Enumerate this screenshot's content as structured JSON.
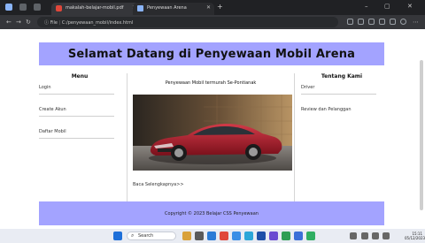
{
  "browser": {
    "tabs": [
      {
        "label": "makalah-belajar-mobil.pdf"
      },
      {
        "label": "Penyewaan Arena"
      }
    ],
    "new_tab": "+",
    "address": {
      "scheme": "File",
      "path": "C:/penyewaan_mobil/index.html"
    }
  },
  "page": {
    "header_title": "Selamat Datang di Penyewaan Mobil Arena",
    "left_menu": {
      "title": "Menu",
      "items": [
        "Login",
        "Create Akun",
        "Daftar Mobil"
      ]
    },
    "main": {
      "title": "Penyewaan Mobil termurah Se-Pontianak",
      "caption": "Baca Selengkapnya>>"
    },
    "right_menu": {
      "title": "Tentang Kami",
      "items": [
        "Driver",
        "Review dan Pelanggan"
      ]
    },
    "footer": "Copyright © 2023 Belajar CSS Penyewaan"
  },
  "taskbar": {
    "search_placeholder": "Search",
    "time": "15:11",
    "date": "05/12/2023"
  },
  "colors": {
    "header_bg": "#a3a3ff",
    "footer_bg": "#a3a3ff",
    "car": "#b21f2d"
  }
}
